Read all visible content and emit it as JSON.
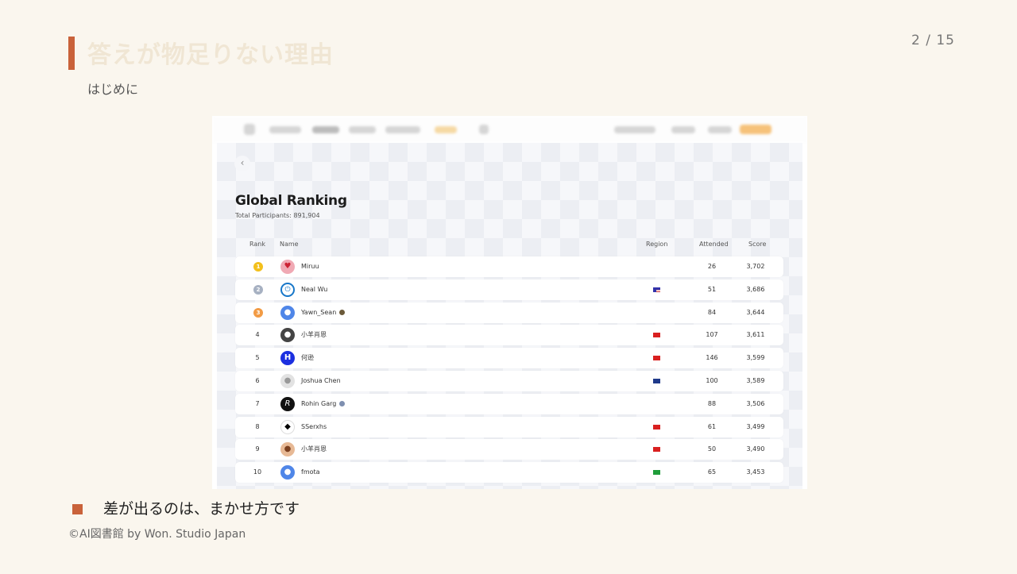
{
  "slide": {
    "title": "答えが物足りない理由",
    "subtitle": "はじめに",
    "page": "2 / 15",
    "bullet": "差が出るのは、まかせ方です",
    "footer": "©AI図書館 by Won. Studio Japan",
    "accent_color": "#c9623a"
  },
  "screenshot": {
    "back_icon": "chevron-left-icon",
    "title": "Global Ranking",
    "subtitle": "Total Participants: 891,904",
    "columns": {
      "rank": "Rank",
      "name": "Name",
      "region": "Region",
      "attended": "Attended",
      "score": "Score"
    },
    "rows": [
      {
        "rank": "1",
        "name": "Miruu",
        "region": "",
        "attended": "26",
        "score": "3,702"
      },
      {
        "rank": "2",
        "name": "Neal Wu",
        "region": "us-flag",
        "attended": "51",
        "score": "3,686"
      },
      {
        "rank": "3",
        "name": "Yawn_Sean",
        "region": "",
        "attended": "84",
        "score": "3,644"
      },
      {
        "rank": "4",
        "name": "小羊肖恩",
        "region": "cn-flag",
        "attended": "107",
        "score": "3,611"
      },
      {
        "rank": "5",
        "name": "何逊",
        "region": "cn-flag",
        "attended": "146",
        "score": "3,599"
      },
      {
        "rank": "6",
        "name": "Joshua Chen",
        "region": "au-flag",
        "attended": "100",
        "score": "3,589"
      },
      {
        "rank": "7",
        "name": "Rohin Garg",
        "region": "",
        "attended": "88",
        "score": "3,506"
      },
      {
        "rank": "8",
        "name": "SSerxhs",
        "region": "cn-flag",
        "attended": "61",
        "score": "3,499"
      },
      {
        "rank": "9",
        "name": "小羊肖恩",
        "region": "cn-flag",
        "attended": "50",
        "score": "3,490"
      },
      {
        "rank": "10",
        "name": "fmota",
        "region": "br-flag",
        "attended": "65",
        "score": "3,453"
      }
    ]
  }
}
